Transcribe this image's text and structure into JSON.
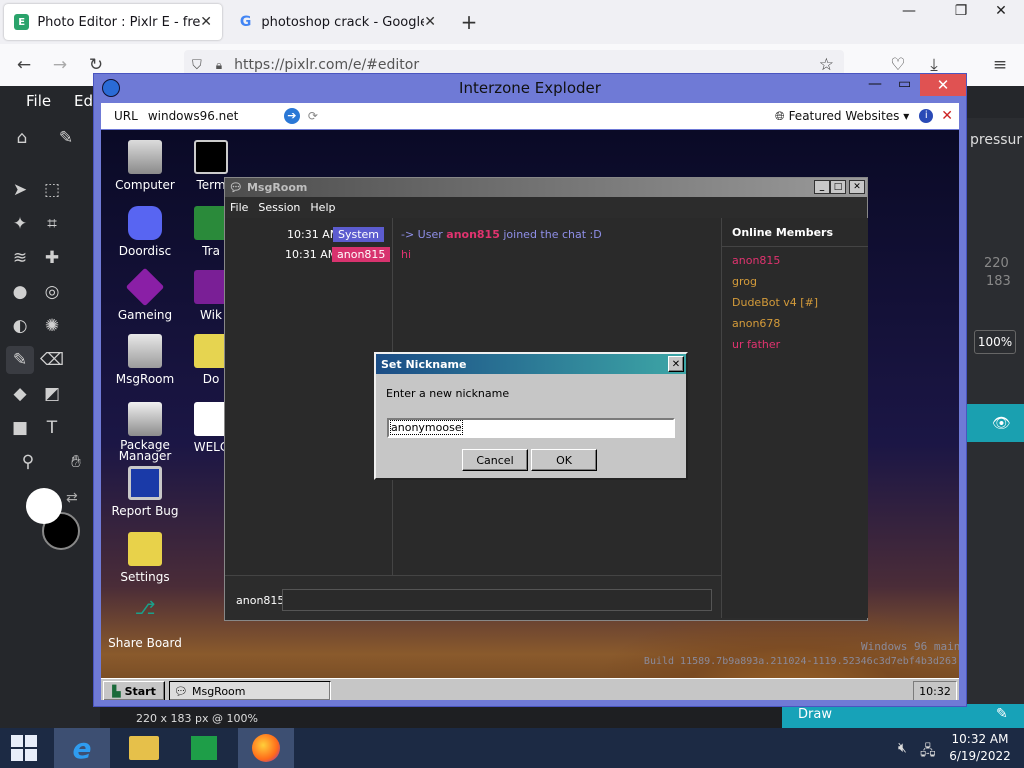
{
  "browser": {
    "tabs": [
      {
        "label": "Photo Editor : Pixlr E - free imag",
        "icon": "pixlr-e-icon"
      },
      {
        "label": "photoshop crack - Google Searc",
        "icon": "google-g-icon"
      }
    ],
    "new_tab": "+",
    "url": "https://pixlr.com/e/#editor",
    "window_controls": {
      "min": "—",
      "max": "❐",
      "close": "✕"
    }
  },
  "pixlr": {
    "menu": [
      "File",
      "Ed"
    ],
    "right_panel": {
      "label": "pressur",
      "w": "220",
      "h": "183",
      "zoom": "100%"
    },
    "status": "220 x 183 px @ 100%",
    "draw_label": "Draw"
  },
  "interzone": {
    "title": "Interzone Exploder",
    "url_label": "URL",
    "url": "windows96.net",
    "featured": "Featured Websites ▾"
  },
  "desktop_icons": [
    {
      "label": "Computer"
    },
    {
      "label": "Doordisc"
    },
    {
      "label": "Gameing"
    },
    {
      "label": "MsgRoom"
    },
    {
      "label": "Package Manager"
    },
    {
      "label": "Report Bug"
    },
    {
      "label": "Settings"
    },
    {
      "label": "Share Board"
    },
    {
      "label": "Term"
    },
    {
      "label": "Tra"
    },
    {
      "label": "Wik"
    },
    {
      "label": "Do"
    },
    {
      "label": "WELC"
    }
  ],
  "msgroom": {
    "title": "MsgRoom",
    "menu": [
      "File",
      "Session",
      "Help"
    ],
    "messages": [
      {
        "time": "10:31 AM",
        "user": "System",
        "text_prefix": "-> User ",
        "text_user": "anon815",
        "text_suffix": " joined the chat :D"
      },
      {
        "time": "10:31 AM",
        "user": "anon815",
        "text": "hi"
      }
    ],
    "members_title": "Online Members",
    "members": [
      "anon815",
      "grog",
      "DudeBot v4 [#]",
      "anon678",
      "ur father"
    ],
    "input_user": "anon815"
  },
  "dialog": {
    "title": "Set Nickname",
    "prompt": "Enter a new nickname",
    "value": "anonymoose",
    "cancel": "Cancel",
    "ok": "OK"
  },
  "w96": {
    "start": "Start",
    "task_item": "MsgRoom",
    "clock": "10:32",
    "watermark1": "Windows 96 main",
    "watermark2": "Build 11589.7b9a893a.211024-1119.52346c3d7ebf4b3d263"
  },
  "windows_taskbar": {
    "time": "10:32 AM",
    "date": "6/19/2022"
  },
  "colors": {
    "system_badge": "#5c5ccf",
    "user_badge": "#d8336e",
    "member_pink": "#e0336f",
    "member_orange": "#d49b3a",
    "izwindow": "#6f7ad6"
  }
}
